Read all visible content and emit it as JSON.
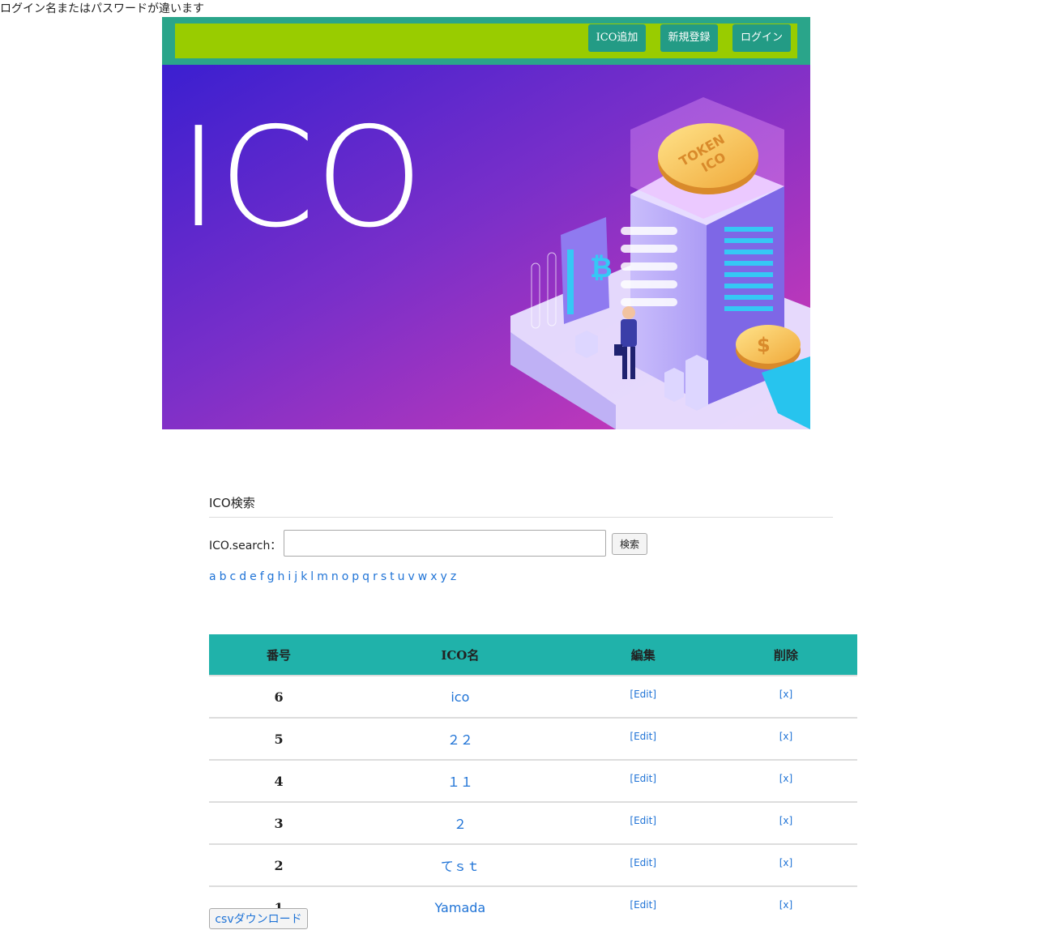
{
  "error_message": "ログイン名またはパスワードが違います",
  "nav": {
    "add_ico": "ICO追加",
    "register": "新規登録",
    "login": "ログイン"
  },
  "banner": {
    "heading": "ICO",
    "coin_text_1": "TOKEN",
    "coin_text_2": "ICO",
    "bitcoin_symbol": "₿",
    "dollar_symbol": "$"
  },
  "search": {
    "title": "ICO検索",
    "label": "ICO.search：",
    "input_value": "",
    "button": "検索",
    "letters": [
      "a",
      "b",
      "c",
      "d",
      "e",
      "f",
      "g",
      "h",
      "i",
      "j",
      "k",
      "l",
      "m",
      "n",
      "o",
      "p",
      "q",
      "r",
      "s",
      "t",
      "u",
      "v",
      "w",
      "x",
      "y",
      "z"
    ]
  },
  "table": {
    "headers": {
      "num": "番号",
      "name": "ICO名",
      "edit": "編集",
      "delete": "削除"
    },
    "rows": [
      {
        "num": "6",
        "name": "ico",
        "edit": "[Edit]",
        "delete": "[x]"
      },
      {
        "num": "5",
        "name": "２２",
        "edit": "[Edit]",
        "delete": "[x]"
      },
      {
        "num": "4",
        "name": "１１",
        "edit": "[Edit]",
        "delete": "[x]"
      },
      {
        "num": "3",
        "name": "２",
        "edit": "[Edit]",
        "delete": "[x]"
      },
      {
        "num": "2",
        "name": "てｓｔ",
        "edit": "[Edit]",
        "delete": "[x]"
      },
      {
        "num": "1",
        "name": "Yamada",
        "edit": "[Edit]",
        "delete": "[x]"
      }
    ]
  },
  "csv_button": "csvダウンロード",
  "colors": {
    "header_outer": "#2aa58a",
    "header_bar": "#99cc00",
    "nav_button": "#239b85",
    "table_header": "#20b2aa",
    "link": "#1f73d6"
  }
}
